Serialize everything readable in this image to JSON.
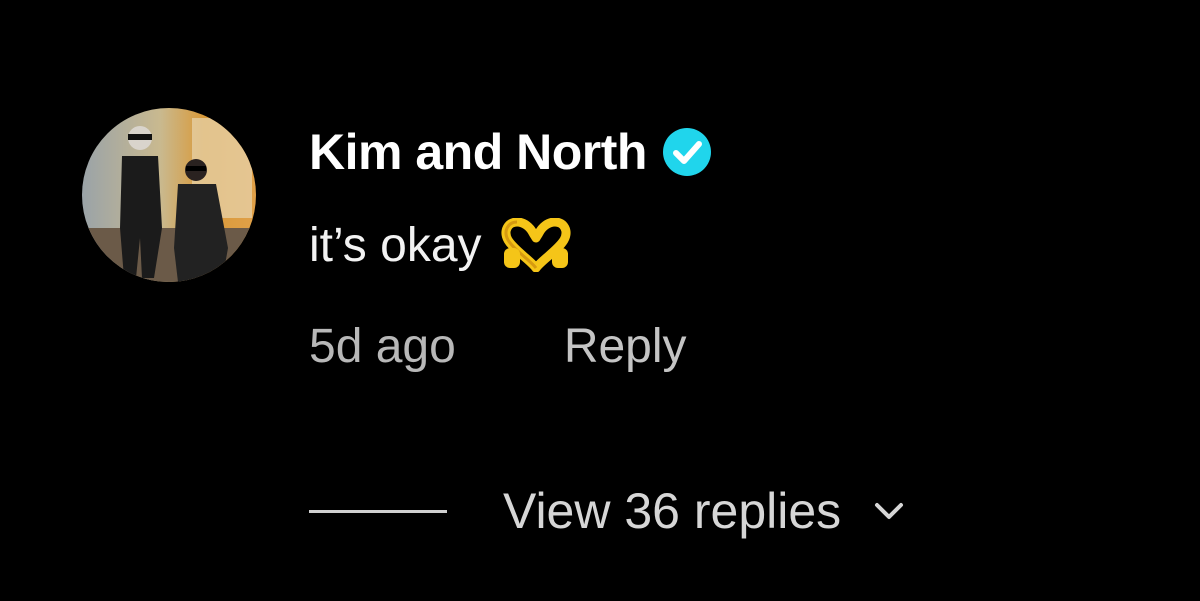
{
  "comment": {
    "username": "Kim and North",
    "verified_icon": "verified-badge-icon",
    "text": "it’s okay",
    "emoji_icon": "heart-hands-emoji",
    "timestamp": "5d ago",
    "reply_label": "Reply",
    "view_replies_label": "View 36 replies",
    "expand_icon": "chevron-down-icon"
  },
  "colors": {
    "background": "#000000",
    "username": "#ffffff",
    "verified": "#20d5ec",
    "emoji": "#f5c518",
    "secondary_text": "#b8b8b8"
  }
}
